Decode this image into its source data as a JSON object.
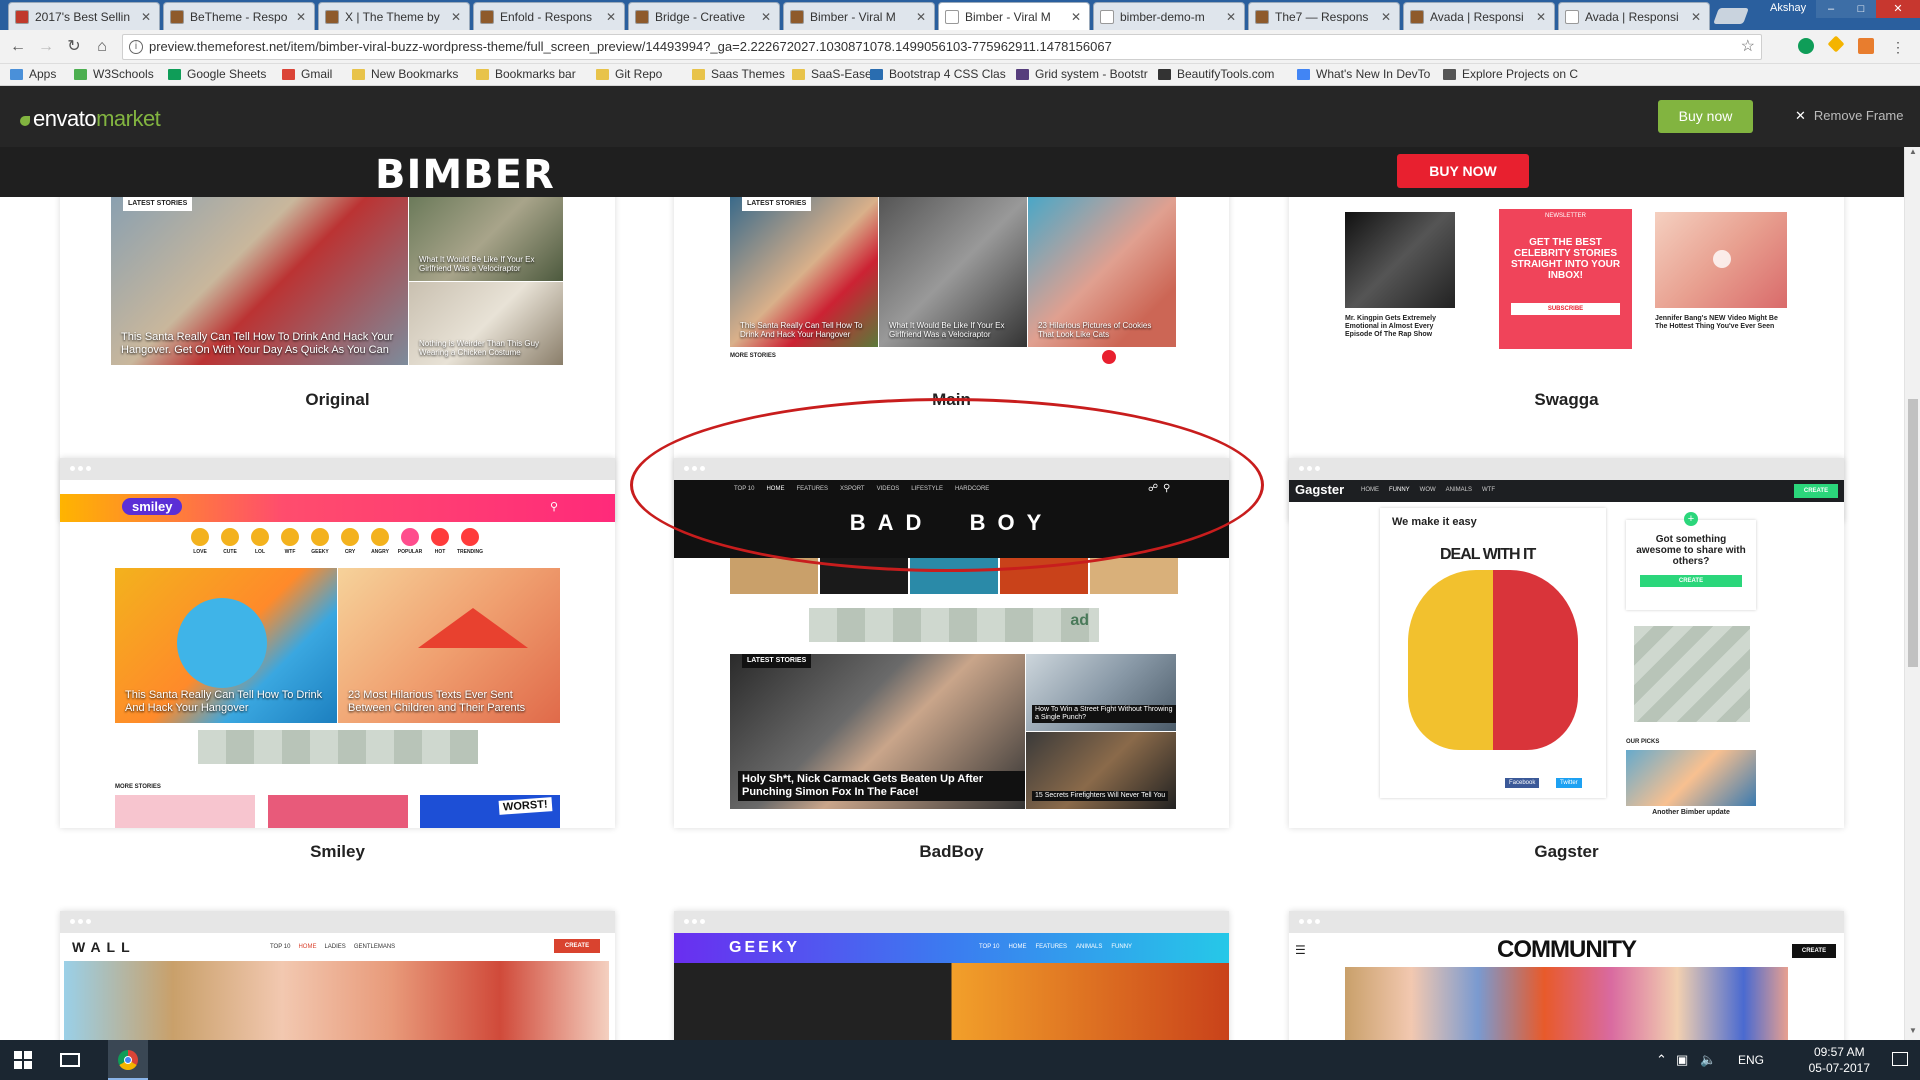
{
  "browser": {
    "tabs": [
      {
        "title": "2017's Best Sellin",
        "favicon_color": "#c0392b"
      },
      {
        "title": "BeTheme - Respo",
        "favicon_color": "#8e5a2b"
      },
      {
        "title": "X | The Theme by",
        "favicon_color": "#8e5a2b"
      },
      {
        "title": "Enfold - Respons",
        "favicon_color": "#8e5a2b"
      },
      {
        "title": "Bridge - Creative",
        "favicon_color": "#8e5a2b"
      },
      {
        "title": "Bimber - Viral M",
        "favicon_color": "#8e5a2b"
      },
      {
        "title": "Bimber - Viral M",
        "favicon_color": "#ffffff"
      },
      {
        "title": "bimber-demo-m",
        "favicon_color": "#ffffff"
      },
      {
        "title": "The7 — Respons",
        "favicon_color": "#8e5a2b"
      },
      {
        "title": "Avada | Responsi",
        "favicon_color": "#8e5a2b"
      },
      {
        "title": "Avada | Responsi",
        "favicon_color": "#ffffff"
      }
    ],
    "active_tab_index": 6,
    "profile_name": "Akshay",
    "url": "preview.themeforest.net/item/bimber-viral-buzz-wordpress-theme/full_screen_preview/14493994?_ga=2.222672027.1030871078.1499056103-775962911.1478156067",
    "bookmarks": [
      {
        "label": "Apps",
        "color": "#4a90d9"
      },
      {
        "label": "W3Schools",
        "color": "#4caf50"
      },
      {
        "label": "Google Sheets",
        "color": "#0f9d58"
      },
      {
        "label": "Gmail",
        "color": "#db4437"
      },
      {
        "label": "New Bookmarks",
        "color": "#e8c34a"
      },
      {
        "label": "Bookmarks bar",
        "color": "#e8c34a"
      },
      {
        "label": "Git Repo",
        "color": "#e8c34a"
      },
      {
        "label": "Saas Themes",
        "color": "#e8c34a"
      },
      {
        "label": "SaaS-Ease",
        "color": "#e8c34a"
      },
      {
        "label": "Bootstrap 4 CSS Clas",
        "color": "#2a6db0"
      },
      {
        "label": "Grid system - Bootstr",
        "color": "#563d7c"
      },
      {
        "label": "BeautifyTools.com",
        "color": "#333333"
      },
      {
        "label": "What's New In DevTo",
        "color": "#4285f4"
      },
      {
        "label": "Explore Projects on C",
        "color": "#555555"
      }
    ]
  },
  "envato": {
    "logo_prefix": "envato",
    "logo_suffix": "market",
    "buy_now": "Buy now",
    "remove_frame": "Remove Frame",
    "accent": "#82b440"
  },
  "bimber": {
    "logo": "BIMBER",
    "buy_now": "BUY NOW",
    "accent": "#e8202f"
  },
  "demos": [
    {
      "name": "Original",
      "tag": "LATEST STORIES",
      "captions": [
        "This Santa Really Can Tell How To Drink And Hack Your Hangover. Get On With Your Day As Quick As You Can",
        "What It Would Be Like If Your Ex Girlfriend Was a Velociraptor",
        "Nothing is Weirder Than This Guy Wearing a Chicken Costume"
      ]
    },
    {
      "name": "Main",
      "tag": "LATEST STORIES",
      "captions": [
        "This Santa Really Can Tell How To Drink And Hack Your Hangover",
        "What It Would Be Like If Your Ex Girlfriend Was a Velociraptor",
        "23 Hilarious Pictures of Cookies That Look Like Cats"
      ],
      "more": "MORE STORIES"
    },
    {
      "name": "Swagga",
      "newsletter_title": "GET THE BEST CELEBRITY STORIES STRAIGHT INTO YOUR INBOX!",
      "newsletter_tag": "NEWSLETTER",
      "subscribe": "SUBSCRIBE",
      "captions": [
        "Mr. Kingpin Gets Extremely Emotional in Almost Every Episode Of The Rap Show",
        "Jennifer Bang's NEW Video Might Be The Hottest Thing You've Ever Seen"
      ]
    },
    {
      "name": "Smiley",
      "logo": "smiley",
      "reactions": [
        "LOVE",
        "CUTE",
        "LOL",
        "WTF",
        "GEEKY",
        "CRY",
        "ANGRY",
        "POPULAR",
        "HOT",
        "TRENDING"
      ],
      "captions": [
        "This Santa Really Can Tell How To Drink And Hack Your Hangover",
        "23 Most Hilarious Texts Ever Sent Between Children and Their Parents"
      ],
      "more": "MORE STORIES",
      "badge": "WORST!"
    },
    {
      "name": "BadBoy",
      "logo": "BAD  BOY",
      "nav": [
        "TOP 10",
        "HOME",
        "FEATURES",
        "XSPORT",
        "VIDEOS",
        "LIFESTYLE",
        "HARDCORE"
      ],
      "tag": "LATEST STORIES",
      "captions": [
        "Holy Sh*t, Nick Carmack Gets Beaten Up After Punching Simon Fox In The Face!",
        "How To Win a Street Fight Without Throwing a Single Punch?",
        "15 Secrets Firefighters Will Never Tell You"
      ],
      "ad": "ad"
    },
    {
      "name": "Gagster",
      "logo": "Gagster",
      "nav": [
        "HOME",
        "FUNNY",
        "WOW",
        "ANIMALS",
        "WTF"
      ],
      "create": "CREATE",
      "headline": "We make it easy",
      "hero_text": "DEAL WITH IT",
      "share_box": "Got something awesome to share with others?",
      "picks": "OUR PICKS",
      "pick_caption": "Another Bimber update",
      "facebook": "Facebook",
      "twitter": "Twitter"
    },
    {
      "name": "Wall",
      "logo": "WALL",
      "nav": [
        "TOP 10",
        "HOME",
        "LADIES",
        "GENTLEMANS"
      ],
      "create": "CREATE"
    },
    {
      "name": "Geeky",
      "logo": "GEEKY",
      "nav": [
        "TOP 10",
        "HOME",
        "FEATURES",
        "ANIMALS",
        "FUNNY"
      ]
    },
    {
      "name": "Community",
      "logo": "COMMUNITY",
      "create": "CREATE"
    }
  ],
  "taskbar": {
    "language": "ENG",
    "time": "09:57 AM",
    "date": "05-07-2017"
  }
}
